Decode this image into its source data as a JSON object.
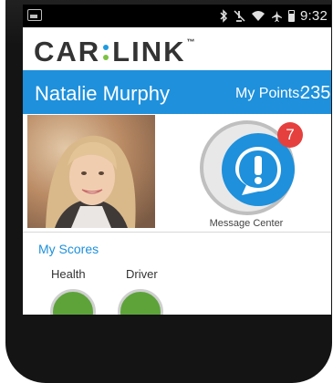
{
  "status_bar": {
    "icons": [
      "gallery-icon",
      "bluetooth-icon",
      "mute-icon",
      "wifi-icon",
      "airplane-icon",
      "battery-icon"
    ],
    "time": "9:32"
  },
  "header": {
    "logo_left": "CAR",
    "logo_right": "LINK",
    "logo_tm": "™"
  },
  "user": {
    "name": "Natalie Murphy",
    "points_label": "My Points:",
    "points_value": "235"
  },
  "message_center": {
    "label": "Message Center",
    "badge_count": "7"
  },
  "scores": {
    "title": "My Scores",
    "items": [
      {
        "label": "Health"
      },
      {
        "label": "Driver"
      }
    ]
  },
  "colors": {
    "brand_blue": "#1e90dc",
    "badge_red": "#e5403e",
    "gauge_green": "#5da33a",
    "logo_green": "#7cc242"
  }
}
